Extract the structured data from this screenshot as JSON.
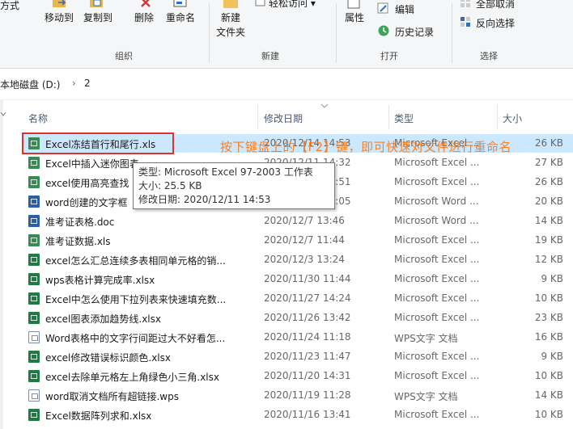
{
  "ribbon": {
    "partial_left": "方式",
    "move_to": "移动到",
    "copy_to": "复制到",
    "delete": "删除",
    "rename": "重命名",
    "new_folder_line1": "新建",
    "new_folder_line2": "文件夹",
    "easy_access": "轻松访问 ▾",
    "properties": "属性",
    "edit": "编辑",
    "history": "历史记录",
    "select_all": "全部取消",
    "invert_selection": "反向选择",
    "groups": {
      "organize": "组织",
      "new": "新建",
      "open": "打开",
      "select": "选择"
    }
  },
  "address": {
    "drive": "本地磁盘 (D:)",
    "sep": "›",
    "folder": "2"
  },
  "columns": {
    "name": "名称",
    "date": "修改日期",
    "type": "类型",
    "size": "大小"
  },
  "files": [
    {
      "name": "Excel冻结首行和尾行.xls",
      "date": "2020/12/14 14:53",
      "type": "Microsoft Excel ...",
      "size": "26 KB",
      "icon": "xls"
    },
    {
      "name": "Excel中插入迷你图表",
      "date": "2020/12/11 14:32",
      "type": "Microsoft Excel ...",
      "size": "27 KB",
      "icon": "xls"
    },
    {
      "name": "excel使用高亮查找",
      "date": "2020/12/11 14:51",
      "type": "Microsoft Excel ...",
      "size": "26 KB",
      "icon": "xls"
    },
    {
      "name": "word创建的文字框",
      "date": "2020/12/11 14:05",
      "type": "Microsoft Word ...",
      "size": "20 KB",
      "icon": "doc"
    },
    {
      "name": "准考证表格.doc",
      "date": "2020/12/7 13:46",
      "type": "Microsoft Word ...",
      "size": "14 KB",
      "icon": "doc"
    },
    {
      "name": "准考证数据.xls",
      "date": "2020/12/7 11:44",
      "type": "Microsoft Excel ...",
      "size": "19 KB",
      "icon": "xls"
    },
    {
      "name": "excel怎么汇总连续多表相同单元格的销...",
      "date": "2020/12/3 13:24",
      "type": "Microsoft Excel ...",
      "size": "12 KB",
      "icon": "xlsx"
    },
    {
      "name": "wps表格计算完成率.xlsx",
      "date": "2020/11/30 11:44",
      "type": "Microsoft Excel ...",
      "size": "9 KB",
      "icon": "xlsx"
    },
    {
      "name": "Excel中怎么使用下拉列表来快速填充数...",
      "date": "2020/11/27 14:24",
      "type": "Microsoft Excel ...",
      "size": "10 KB",
      "icon": "xlsx"
    },
    {
      "name": "excel图表添加趋势线.xlsx",
      "date": "2020/11/26 13:42",
      "type": "Microsoft Excel ...",
      "size": "23 KB",
      "icon": "xlsx"
    },
    {
      "name": "Word表格中的文字行间距过大不好看怎...",
      "date": "2020/11/24 11:18",
      "type": "WPS文字 文档",
      "size": "16 KB",
      "icon": "wps"
    },
    {
      "name": "excel修改错误标识颜色.xlsx",
      "date": "2020/11/23 11:47",
      "type": "Microsoft Excel ...",
      "size": "9 KB",
      "icon": "xlsx"
    },
    {
      "name": "excel去除单元格左上角绿色小三角.xlsx",
      "date": "2020/11/20 14:31",
      "type": "Microsoft Excel ...",
      "size": "10 KB",
      "icon": "xlsx"
    },
    {
      "name": "word取消文档所有超链接.wps",
      "date": "2020/11/19 11:28",
      "type": "WPS文字 文档",
      "size": "14 KB",
      "icon": "wps"
    },
    {
      "name": "Excel数据阵列求和.xlsx",
      "date": "2020/11/16 13:41",
      "type": "Microsoft Excel ...",
      "size": "10 KB",
      "icon": "xlsx"
    }
  ],
  "annotation": "按下键盘上的【F2】键，即可快速对文件进行重命名",
  "tooltip": {
    "type": "类型: Microsoft Excel 97-2003 工作表",
    "size": "大小: 25.5 KB",
    "modified": "修改日期: 2020/12/11 14:53"
  }
}
